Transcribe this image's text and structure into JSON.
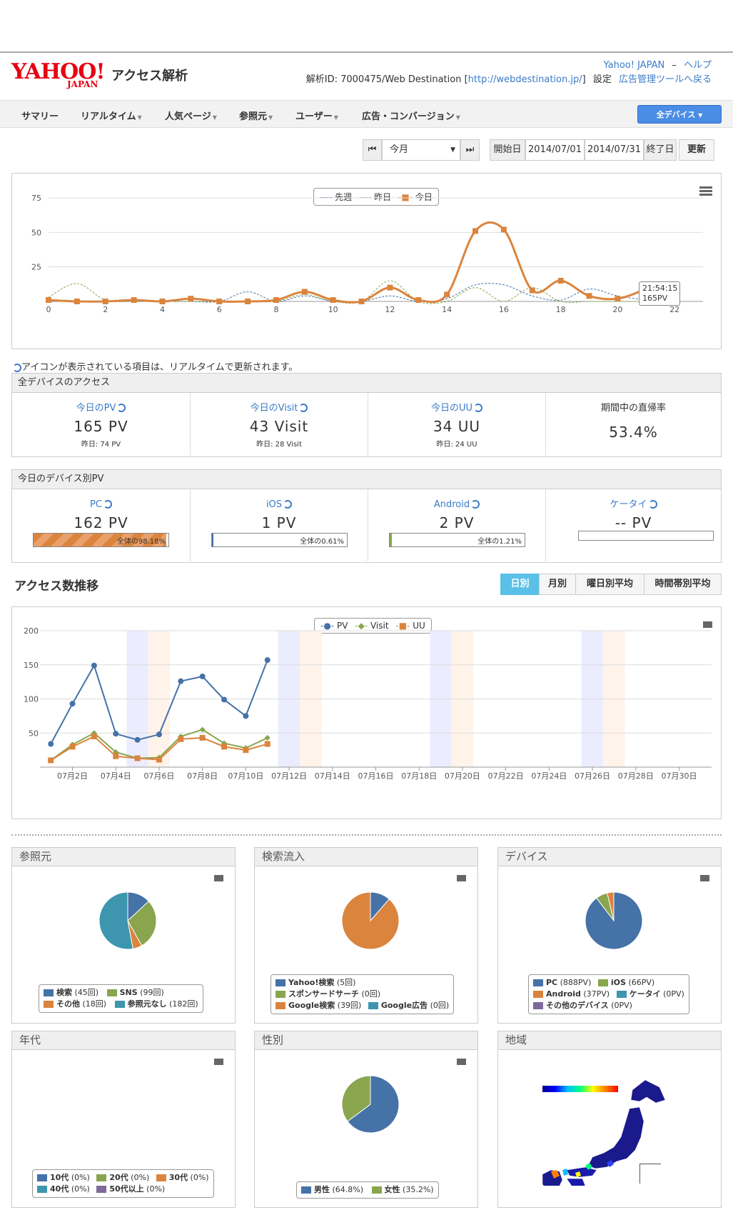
{
  "header": {
    "logo_text": "YAHOO!",
    "logo_sub": "JAPAN",
    "app_title": "アクセス解析",
    "link_yahoo": "Yahoo! JAPAN",
    "sep": "–",
    "link_help": "ヘルプ",
    "analysis_id": "解析ID: 7000475/Web Destination [",
    "site_url": "http://webdestination.jp/",
    "bracket_close": "]",
    "link_settings": "設定",
    "link_admin": "広告管理ツールへ戻る"
  },
  "nav": {
    "items": [
      "サマリー",
      "リアルタイム",
      "人気ページ",
      "参照元",
      "ユーザー",
      "広告・コンバージョン"
    ],
    "device_button": "全デバイス"
  },
  "period": {
    "selected": "今月",
    "start_label": "開始日",
    "start_date": "2014/07/01",
    "end_date": "2014/07/31",
    "end_label": "終了日",
    "update": "更新"
  },
  "realtime_chart": {
    "legend": [
      "先週",
      "昨日",
      "今日"
    ],
    "y_ticks": [
      "75",
      "50",
      "25"
    ],
    "x_ticks": [
      "0",
      "2",
      "4",
      "6",
      "8",
      "10",
      "12",
      "14",
      "16",
      "18",
      "20",
      "22"
    ],
    "tooltip_time": "21:54:15",
    "tooltip_value": "165PV"
  },
  "chart_data": [
    {
      "type": "line",
      "x": [
        0,
        1,
        2,
        3,
        4,
        5,
        6,
        7,
        8,
        9,
        10,
        11,
        12,
        13,
        14,
        15,
        16,
        17,
        18,
        19,
        20,
        21
      ],
      "series": [
        {
          "name": "今日",
          "values": [
            1,
            0,
            0,
            1,
            0,
            2,
            0,
            0,
            1,
            7,
            1,
            0,
            10,
            1,
            5,
            51,
            52,
            8,
            15,
            4,
            2,
            9
          ]
        },
        {
          "name": "昨日",
          "values": [
            3,
            13,
            1,
            0,
            0,
            0,
            0,
            0,
            0,
            5,
            0,
            0,
            15,
            0,
            0,
            10,
            0,
            10,
            0,
            0,
            0,
            0
          ]
        },
        {
          "name": "先週",
          "values": [
            0,
            0,
            0,
            0,
            0,
            0,
            0,
            7,
            0,
            4,
            0,
            0,
            4,
            0,
            2,
            12,
            12,
            4,
            1,
            9,
            4,
            1
          ]
        }
      ],
      "ylim": [
        0,
        75
      ],
      "xlim": [
        0,
        23
      ]
    },
    {
      "type": "line",
      "categories": [
        "07月1日",
        "07月2日",
        "07月3日",
        "07月4日",
        "07月5日",
        "07月6日",
        "07月7日",
        "07月8日",
        "07月9日",
        "07月10日",
        "07月11日"
      ],
      "series": [
        {
          "name": "PV",
          "values": [
            34,
            93,
            149,
            49,
            40,
            48,
            126,
            133,
            99,
            75,
            157
          ]
        },
        {
          "name": "Visit",
          "values": [
            10,
            33,
            50,
            22,
            13,
            14,
            45,
            55,
            35,
            28,
            43
          ]
        },
        {
          "name": "UU",
          "values": [
            10,
            30,
            45,
            16,
            13,
            11,
            41,
            43,
            30,
            25,
            34
          ]
        }
      ],
      "ylim": [
        0,
        200
      ],
      "y_ticks": [
        "200",
        "150",
        "100",
        "50"
      ],
      "x_ticks": [
        "07月2日",
        "07月4日",
        "07月6日",
        "07月8日",
        "07月10日",
        "07月12日",
        "07月14日",
        "07月16日",
        "07月18日",
        "07月20日",
        "07月22日",
        "07月24日",
        "07月26日",
        "07月28日",
        "07月30日"
      ]
    },
    {
      "type": "pie",
      "title": "参照元",
      "labels": [
        "検索",
        "SNS",
        "その他",
        "参照元なし"
      ],
      "values": [
        45,
        99,
        18,
        182
      ]
    },
    {
      "type": "pie",
      "title": "検索流入",
      "labels": [
        "Yahoo!検索",
        "スポンサードサーチ",
        "Google検索",
        "Google広告"
      ],
      "values": [
        5,
        0,
        39,
        0
      ]
    },
    {
      "type": "pie",
      "title": "デバイス",
      "labels": [
        "PC",
        "iOS",
        "Android",
        "ケータイ",
        "その他のデバイス"
      ],
      "values": [
        888,
        66,
        37,
        0,
        0
      ]
    },
    {
      "type": "pie",
      "title": "性別",
      "labels": [
        "男性",
        "女性"
      ],
      "values": [
        64.8,
        35.2
      ]
    }
  ],
  "note": "アイコンが表示されている項目は、リアルタイムで更新されます。",
  "all_access": {
    "title": "全デバイスのアクセス",
    "cells": [
      {
        "label": "今日のPV",
        "value": "165 PV",
        "sub": "昨日: 74 PV"
      },
      {
        "label": "今日のVisit",
        "value": "43 Visit",
        "sub": "昨日: 28 Visit"
      },
      {
        "label": "今日のUU",
        "value": "34 UU",
        "sub": "昨日: 24 UU"
      },
      {
        "label": "期間中の直帰率",
        "value": "53.4%",
        "sub": ""
      }
    ]
  },
  "device_pv": {
    "title": "今日のデバイス別PV",
    "cells": [
      {
        "label": "PC",
        "value": "162 PV",
        "bar_text": "全体の98.18%",
        "bar_fraction": 0.9818
      },
      {
        "label": "iOS",
        "value": "1 PV",
        "bar_text": "全体の0.61%",
        "bar_fraction": 0.0061
      },
      {
        "label": "Android",
        "value": "2 PV",
        "bar_text": "全体の1.21%",
        "bar_fraction": 0.0121
      },
      {
        "label": "ケータイ",
        "value": "-- PV",
        "bar_text": "",
        "bar_fraction": 0
      }
    ]
  },
  "trend": {
    "title": "アクセス数推移",
    "tabs": [
      "日別",
      "月別",
      "曜日別平均",
      "時間帯別平均"
    ],
    "legend": [
      "PV",
      "Visit",
      "UU"
    ]
  },
  "mini": {
    "referrer": {
      "title": "参照元",
      "legend": [
        [
          "検索",
          "(45回)"
        ],
        [
          "SNS",
          "(99回)"
        ],
        [
          "その他",
          "(18回)"
        ],
        [
          "参照元なし",
          "(182回)"
        ]
      ]
    },
    "search": {
      "title": "検索流入",
      "legend": [
        [
          "Yahoo!検索",
          "(5回)"
        ],
        [
          "スポンサードサーチ",
          "(0回)"
        ],
        [
          "Google検索",
          "(39回)"
        ],
        [
          "Google広告",
          "(0回)"
        ]
      ]
    },
    "device": {
      "title": "デバイス",
      "legend": [
        [
          "PC",
          "(888PV)"
        ],
        [
          "iOS",
          "(66PV)"
        ],
        [
          "Android",
          "(37PV)"
        ],
        [
          "ケータイ",
          "(0PV)"
        ],
        [
          "その他のデバイス",
          "(0PV)"
        ]
      ]
    },
    "age": {
      "title": "年代",
      "legend": [
        [
          "10代",
          "(0%)"
        ],
        [
          "20代",
          "(0%)"
        ],
        [
          "30代",
          "(0%)"
        ],
        [
          "40代",
          "(0%)"
        ],
        [
          "50代以上",
          "(0%)"
        ]
      ]
    },
    "gender": {
      "title": "性別",
      "legend": [
        [
          "男性",
          "(64.8%)"
        ],
        [
          "女性",
          "(35.2%)"
        ]
      ]
    },
    "region": {
      "title": "地域"
    }
  },
  "colors": {
    "blue": "#4572a7",
    "green": "#89a54e",
    "orange": "#db843d",
    "teal": "#3d96ae",
    "purple": "#80699b",
    "accent": "#4a8de6"
  }
}
